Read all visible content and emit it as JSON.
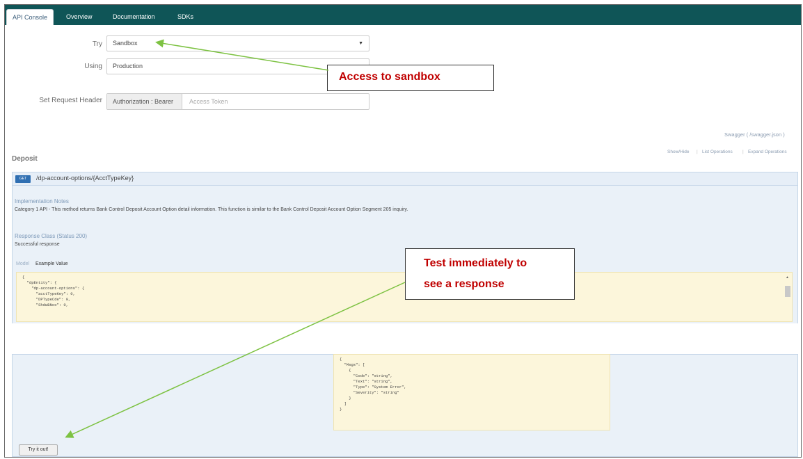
{
  "tabs": [
    {
      "label": "API Console"
    },
    {
      "label": "Overview"
    },
    {
      "label": "Documentation"
    },
    {
      "label": "SDKs"
    }
  ],
  "form": {
    "try_label": "Try",
    "try_value": "Sandbox",
    "using_label": "Using",
    "using_value": "Production",
    "header_label": "Set Request Header",
    "auth_addon": "Authorization : Bearer",
    "token_placeholder": "Access Token"
  },
  "links": {
    "swagger": "Swagger ( /swagger.json )",
    "show_hide": "Show/Hide",
    "list_ops": "List Operations",
    "expand_ops": "Expand Operations"
  },
  "section": {
    "title": "Deposit"
  },
  "operation": {
    "method": "GET",
    "path": "/dp-account-options/{AcctTypeKey}",
    "impl_notes_title": "Implementation Notes",
    "impl_notes_text": "Category 1 API - This method returns Bank Control Deposit Account Option detail information. This function is similar to the Bank Control Deposit Account Option Segment 205 inquiry.",
    "response_class_title": "Response Class (Status 200)",
    "response_class_text": "Successful response",
    "model_label": "Model",
    "example_label": "Example Value",
    "code_example": "{\n  \"dpEntity\": {\n    \"dp-account-options\": {\n      \"acctTypeKey\": 0,\n      \"DPTypeCde\": 0,\n      \"ShdwBNoo\": 0,",
    "code_error": "{\n  \"Msgs\": [\n    {\n      \"Code\": \"string\",\n      \"Text\": \"string\",\n      \"Type\": \"System Error\",\n      \"Severity\": \"string\"\n    }\n  ]\n}",
    "try_button": "Try it out!"
  },
  "callouts": {
    "sandbox": "Access to sandbox",
    "test_line1": "Test immediately to",
    "test_line2": "see a response"
  },
  "colors": {
    "navbar": "#0f5557",
    "callout_text": "#c00000",
    "arrow": "#7dc242",
    "get_badge": "#2f6fb2"
  }
}
